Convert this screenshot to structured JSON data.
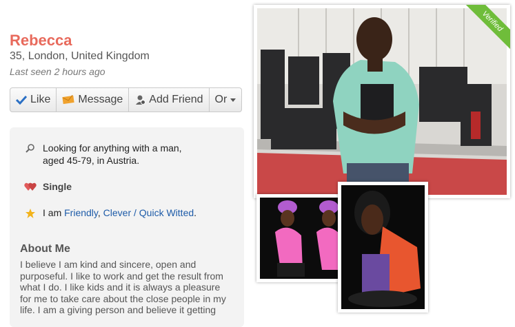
{
  "profile": {
    "name": "Rebecca",
    "location": "35, London, United Kingdom",
    "last_seen": "Last seen 2 hours ago"
  },
  "actions": {
    "like": "Like",
    "message": "Message",
    "add_friend": "Add Friend",
    "more": "Or"
  },
  "details": {
    "looking_line1": "Looking for anything with a man,",
    "looking_line2": "aged 45-79, in Austria.",
    "status": "Single",
    "traits_prefix": "I am ",
    "trait1": "Friendly",
    "trait_sep": ", ",
    "trait2": "Clever / Quick Witted",
    "trait_end": "."
  },
  "about": {
    "heading": "About Me",
    "text": "I believe I am kind and sincere, open and purposeful. I like to work and get the result from what I do. I like kids and it is always a pleasure for me to take care about the close people in my life. I am a giving person and believe it getting"
  },
  "photos": {
    "verified_label": "Verified"
  },
  "colors": {
    "name": "#e86a5c",
    "link": "#1d5ba8",
    "verified": "#6fbd3a",
    "heart": "#e05a5a",
    "star": "#f2b31c"
  }
}
